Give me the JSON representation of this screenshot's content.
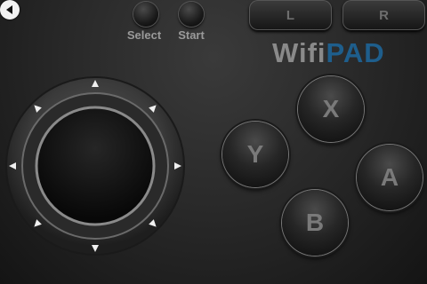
{
  "app": {
    "brand_part1": "Wifi",
    "brand_part2": "PAD"
  },
  "top_controls": {
    "back_icon": "back-arrow-icon",
    "select_label": "Select",
    "start_label": "Start",
    "l_label": "L",
    "r_label": "R"
  },
  "face_buttons": {
    "x_label": "X",
    "y_label": "Y",
    "a_label": "A",
    "b_label": "B"
  },
  "joystick": {
    "direction_marker_icon": "triangle-arrow-icon",
    "marker_count": 8
  },
  "colors": {
    "background": "#2a2a2a",
    "brand_grey": "#8a8a8a",
    "brand_blue": "#1e5e8c",
    "label_grey": "#9a9a9a"
  }
}
